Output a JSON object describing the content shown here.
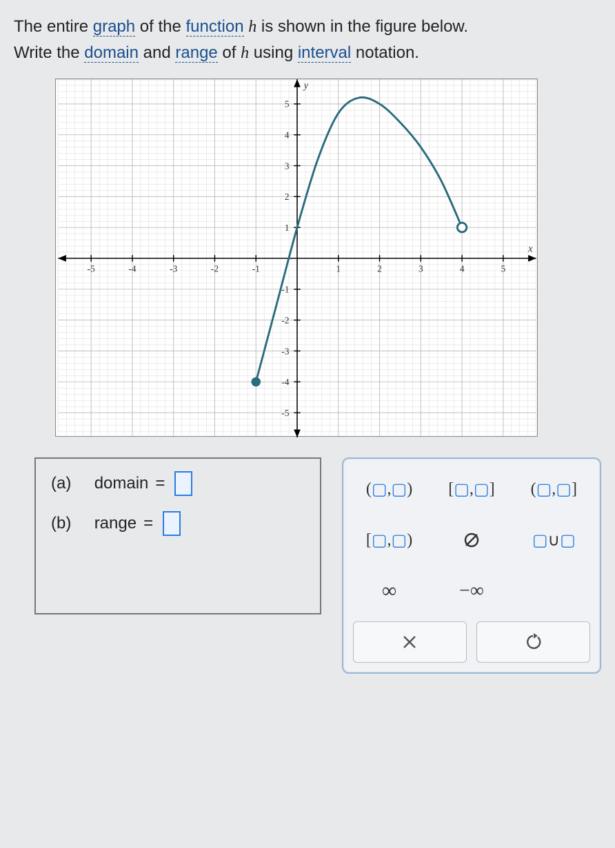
{
  "prompt": {
    "line1_a": "The entire ",
    "link_graph": "graph",
    "line1_b": " of the ",
    "link_function": "function",
    "line1_c": " ",
    "func_name": "h",
    "line1_d": " is shown in the figure below.",
    "line2_a": "Write the ",
    "link_domain": "domain",
    "line2_b": " and ",
    "link_range": "range",
    "line2_c": " of ",
    "line2_d": " using ",
    "link_interval": "interval",
    "line2_e": " notation."
  },
  "answers": {
    "a_label": "(a)",
    "a_text": "domain",
    "b_label": "(b)",
    "b_text": "range",
    "equals": "="
  },
  "keypad": {
    "open_open": "(▢,▢)",
    "closed_closed": "[▢,▢]",
    "open_closed": "(▢,▢]",
    "closed_open": "[▢,▢)",
    "empty_set": "∅",
    "union": "▢∪▢",
    "infinity": "∞",
    "neg_infinity": "−∞",
    "clear": "×",
    "reset": "↺"
  },
  "chart_data": {
    "type": "line",
    "xlabel": "x",
    "ylabel": "y",
    "xticks": [
      -5,
      -4,
      -3,
      -2,
      -1,
      1,
      2,
      3,
      4,
      5
    ],
    "yticks": [
      -5,
      -4,
      -3,
      -2,
      -1,
      1,
      2,
      3,
      4,
      5
    ],
    "xlim": [
      -5.8,
      5.8
    ],
    "ylim": [
      -5.8,
      5.8
    ],
    "endpoints": [
      {
        "x": -1,
        "y": -4,
        "type": "closed"
      },
      {
        "x": 4,
        "y": 1,
        "type": "open"
      }
    ],
    "vertex_approx": {
      "x": 1.5,
      "y": 5.2
    },
    "curve_description": "downward opening parabola-like curve from closed point (-1,-4) through roughly (0,1),(1,4.7),(1.5,5.2),(2,5),(3,3.6),(4,1) open",
    "data_points": [
      {
        "x": -1.0,
        "y": -4.0
      },
      {
        "x": -0.5,
        "y": -1.5
      },
      {
        "x": 0.0,
        "y": 1.0
      },
      {
        "x": 0.5,
        "y": 3.2
      },
      {
        "x": 1.0,
        "y": 4.7
      },
      {
        "x": 1.5,
        "y": 5.2
      },
      {
        "x": 2.0,
        "y": 5.0
      },
      {
        "x": 2.5,
        "y": 4.4
      },
      {
        "x": 3.0,
        "y": 3.6
      },
      {
        "x": 3.5,
        "y": 2.5
      },
      {
        "x": 4.0,
        "y": 1.0
      }
    ]
  }
}
